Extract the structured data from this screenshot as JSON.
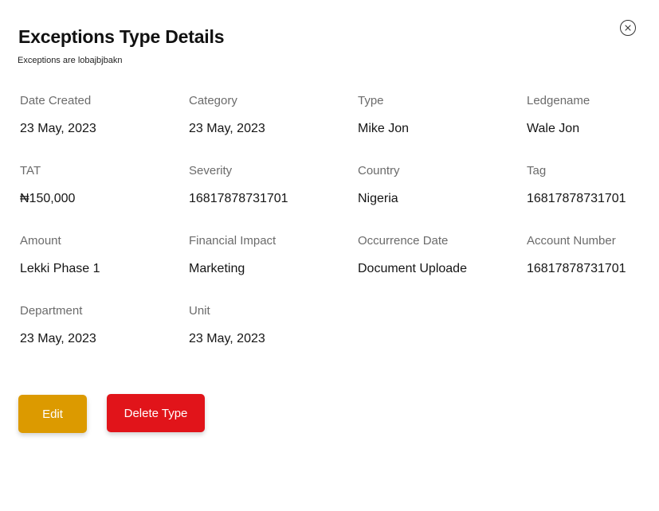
{
  "header": {
    "title": "Exceptions Type Details",
    "subtitle": "Exceptions are lobajbjbakn",
    "close_icon": "close-icon"
  },
  "fields": [
    {
      "label": "Date Created",
      "value": "23 May, 2023"
    },
    {
      "label": "Category",
      "value": "23 May, 2023"
    },
    {
      "label": "Type",
      "value": "Mike Jon"
    },
    {
      "label": "Ledgename",
      "value": "Wale Jon"
    },
    {
      "label": "TAT",
      "value": "₦150,000"
    },
    {
      "label": "Severity",
      "value": "16817878731701"
    },
    {
      "label": "Country",
      "value": "Nigeria"
    },
    {
      "label": "Tag",
      "value": "16817878731701"
    },
    {
      "label": "Amount",
      "value": "Lekki Phase 1"
    },
    {
      "label": "Financial Impact",
      "value": "Marketing"
    },
    {
      "label": "Occurrence Date",
      "value": "Document Uploade"
    },
    {
      "label": "Account Number",
      "value": "16817878731701"
    },
    {
      "label": "Department",
      "value": "23 May, 2023"
    },
    {
      "label": "Unit",
      "value": "23 May, 2023"
    }
  ],
  "actions": {
    "edit_label": "Edit",
    "delete_label": "Delete Type"
  },
  "colors": {
    "edit_button": "#DC9A00",
    "delete_button": "#E1141A",
    "label_text": "#6b6b6b",
    "value_text": "#151515"
  }
}
